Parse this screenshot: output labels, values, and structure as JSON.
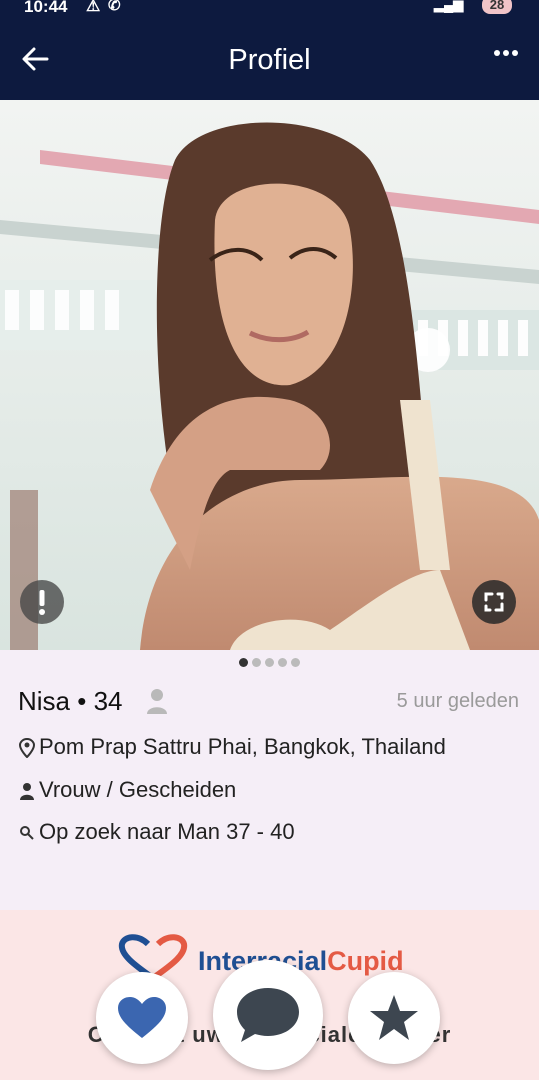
{
  "status_bar": {
    "time": "10:44",
    "battery": "28"
  },
  "header": {
    "title": "Profiel"
  },
  "profile": {
    "name_age": "Nisa • 34",
    "last_seen": "5 uur geleden",
    "location": "Pom Prap Sattru Phai, Bangkok, Thailand",
    "gender_status": "Vrouw / Gescheiden",
    "looking_for": "Op zoek naar Man 37 - 40",
    "photo_count": 5,
    "active_photo": 1
  },
  "banner": {
    "brand_part1": "Interracial",
    "brand_part2": "Cupid",
    "tagline": "Ontmoet uw interraciale partner"
  },
  "colors": {
    "header_bg": "#0d1a3f",
    "like": "#3b66b0",
    "chat": "#3d4650",
    "star": "#3d4650"
  }
}
